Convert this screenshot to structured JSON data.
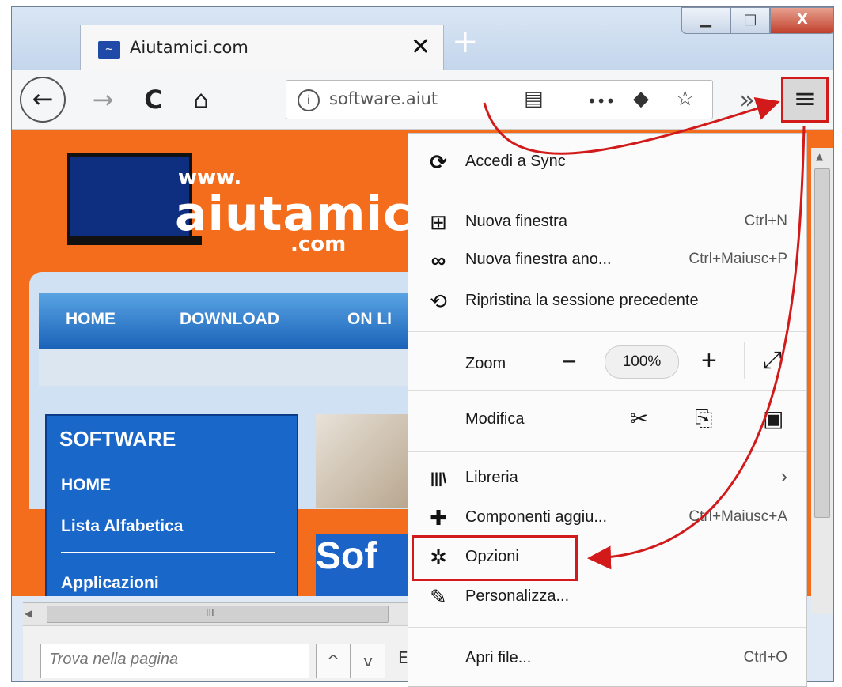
{
  "tab": {
    "title": "Aiutamici.com",
    "close": "✕",
    "favicon": "~"
  },
  "window": {
    "minimize": "▁",
    "maximize": "□",
    "close": "X",
    "new_tab": "+"
  },
  "nav": {
    "back": "←",
    "forward": "→",
    "reload": "C",
    "home": "⌂",
    "url": "software.aiut",
    "info": "i",
    "reader": "▤",
    "more": "•••",
    "pocket": "◆",
    "star": "☆",
    "overflow": "»",
    "menu": "≡"
  },
  "site": {
    "logo_www": "www.",
    "logo_name": "aiutamici",
    "logo_com": ".com",
    "nav": [
      "HOME",
      "DOWNLOAD",
      "ON LI"
    ],
    "side_title": "SOFTWARE",
    "side_items": [
      "HOME",
      "Lista Alfabetica",
      "Applicazioni"
    ],
    "promo": "Sof"
  },
  "findbar": {
    "placeholder": "Trova nella pagina",
    "up": "^",
    "down": "v",
    "trailing": "E"
  },
  "scroll": {
    "hgrip": "III"
  },
  "menu": {
    "sync": {
      "icon": "⟳",
      "label": "Accedi a Sync"
    },
    "new_window": {
      "icon": "⊞",
      "label": "Nuova finestra",
      "shortcut": "Ctrl+N"
    },
    "private": {
      "icon": "∞",
      "label": "Nuova finestra ano...",
      "shortcut": "Ctrl+Maiusc+P"
    },
    "restore": {
      "icon": "⟲",
      "label": "Ripristina la sessione precedente"
    },
    "zoom": {
      "label": "Zoom",
      "minus": "−",
      "value": "100%",
      "plus": "+",
      "fullscreen": "⤢"
    },
    "edit": {
      "label": "Modifica",
      "cut": "✂",
      "copy": "⎘",
      "paste": "▣"
    },
    "library": {
      "icon": "|||\\",
      "label": "Libreria",
      "arrow": "›"
    },
    "addons": {
      "icon": "✚",
      "label": "Componenti aggiu...",
      "shortcut": "Ctrl+Maiusc+A"
    },
    "options": {
      "icon": "✲",
      "label": "Opzioni"
    },
    "customize": {
      "icon": "✎",
      "label": "Personalizza..."
    },
    "open_file": {
      "label": "Apri file...",
      "shortcut": "Ctrl+O"
    }
  },
  "colors": {
    "accent_red": "#d21a1a",
    "site_orange": "#f46d1d",
    "site_blue": "#1967c9"
  }
}
